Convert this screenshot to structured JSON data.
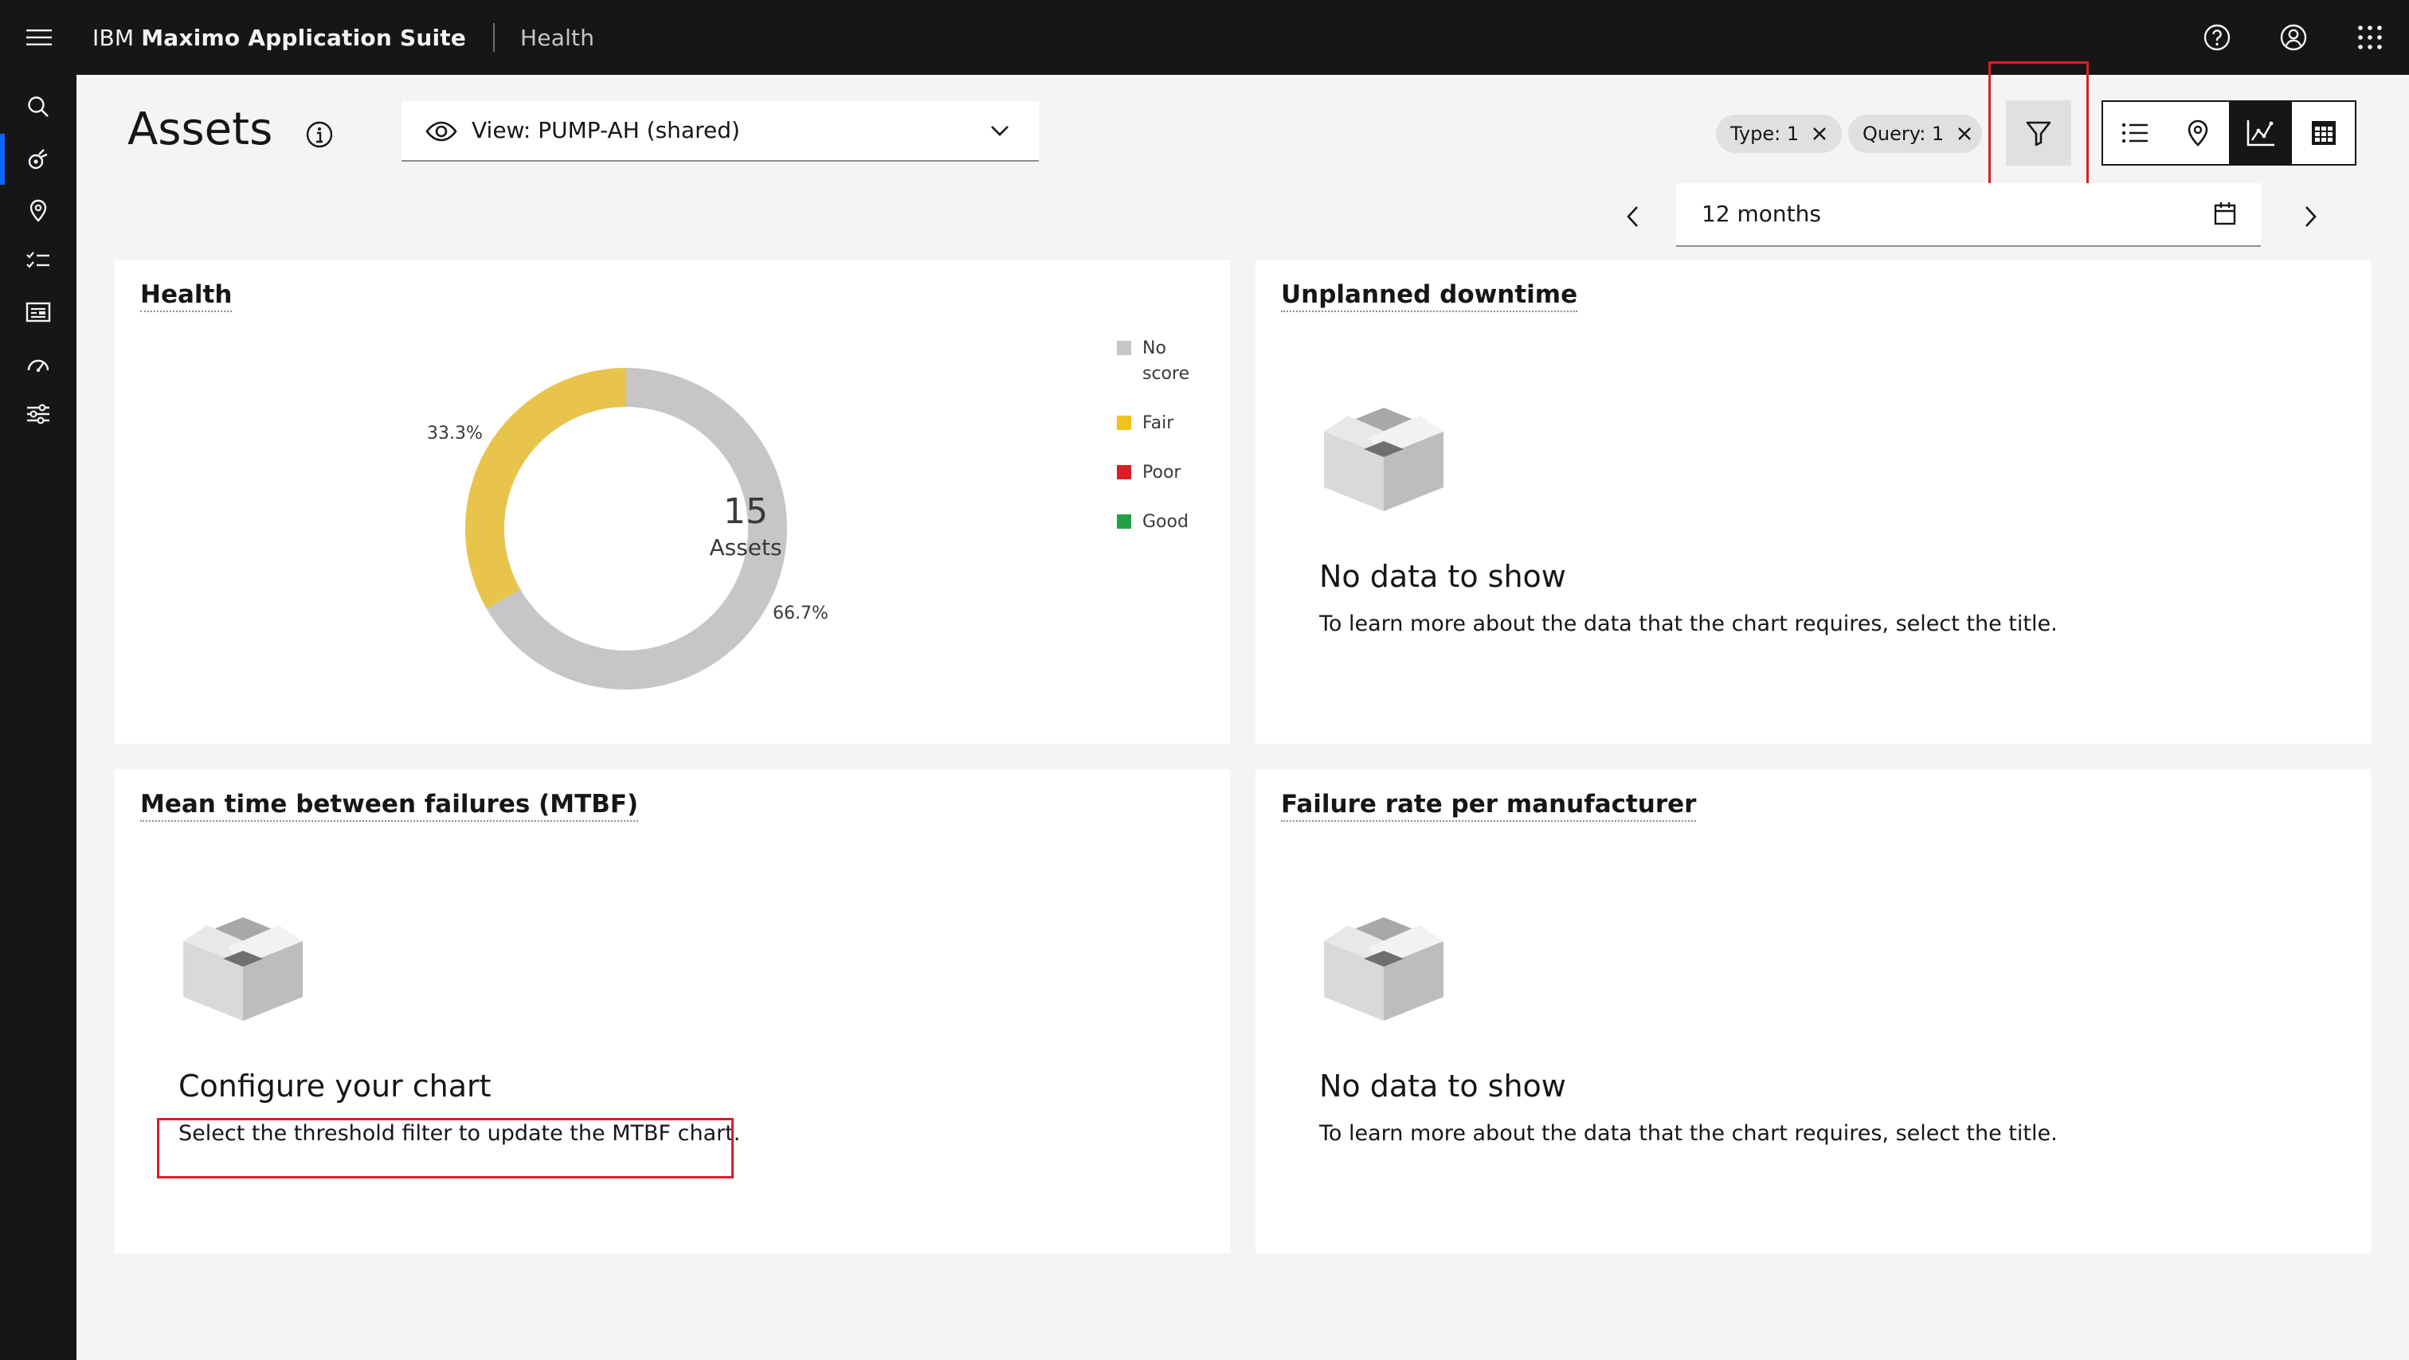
{
  "topbar": {
    "brand_prefix": "IBM",
    "brand_name": "Maximo Application Suite",
    "app_name": "Health"
  },
  "header": {
    "title": "Assets",
    "view_label": "View: PUMP-AH (shared)",
    "tags": [
      {
        "label": "Type: 1"
      },
      {
        "label": "Query: 1"
      }
    ],
    "date_range": "12 months"
  },
  "cards": {
    "health": {
      "title": "Health",
      "total": "15",
      "total_label": "Assets",
      "legend": [
        {
          "label": "No score",
          "color": "#c6c6c6"
        },
        {
          "label": "Fair",
          "color": "#f1c21b"
        },
        {
          "label": "Poor",
          "color": "#da1e28"
        },
        {
          "label": "Good",
          "color": "#24a148"
        }
      ],
      "slice_labels": {
        "fair": "33.3%",
        "no_score": "66.7%"
      }
    },
    "downtime": {
      "title": "Unplanned downtime",
      "empty_title": "No data to show",
      "empty_desc": "To learn more about the data that the chart requires, select the title."
    },
    "mtbf": {
      "title": "Mean time between failures (MTBF)",
      "empty_title": "Configure your chart",
      "empty_desc": "Select the threshold filter to update the MTBF chart."
    },
    "failure": {
      "title": "Failure rate per manufacturer",
      "empty_title": "No data to show",
      "empty_desc": "To learn more about the data that the chart requires, select the title."
    }
  },
  "colors": {
    "no_score": "#c6c6c6",
    "fair": "#e8c44c",
    "poor": "#da1e28",
    "good": "#24a148",
    "highlight": "#da1e28",
    "accent": "#0f62fe"
  },
  "chart_data": {
    "type": "pie",
    "title": "Health",
    "categories": [
      "No score",
      "Fair",
      "Poor",
      "Good"
    ],
    "values": [
      66.7,
      33.3,
      0,
      0
    ],
    "center_value": 15,
    "center_label": "Assets",
    "legend_position": "right"
  }
}
